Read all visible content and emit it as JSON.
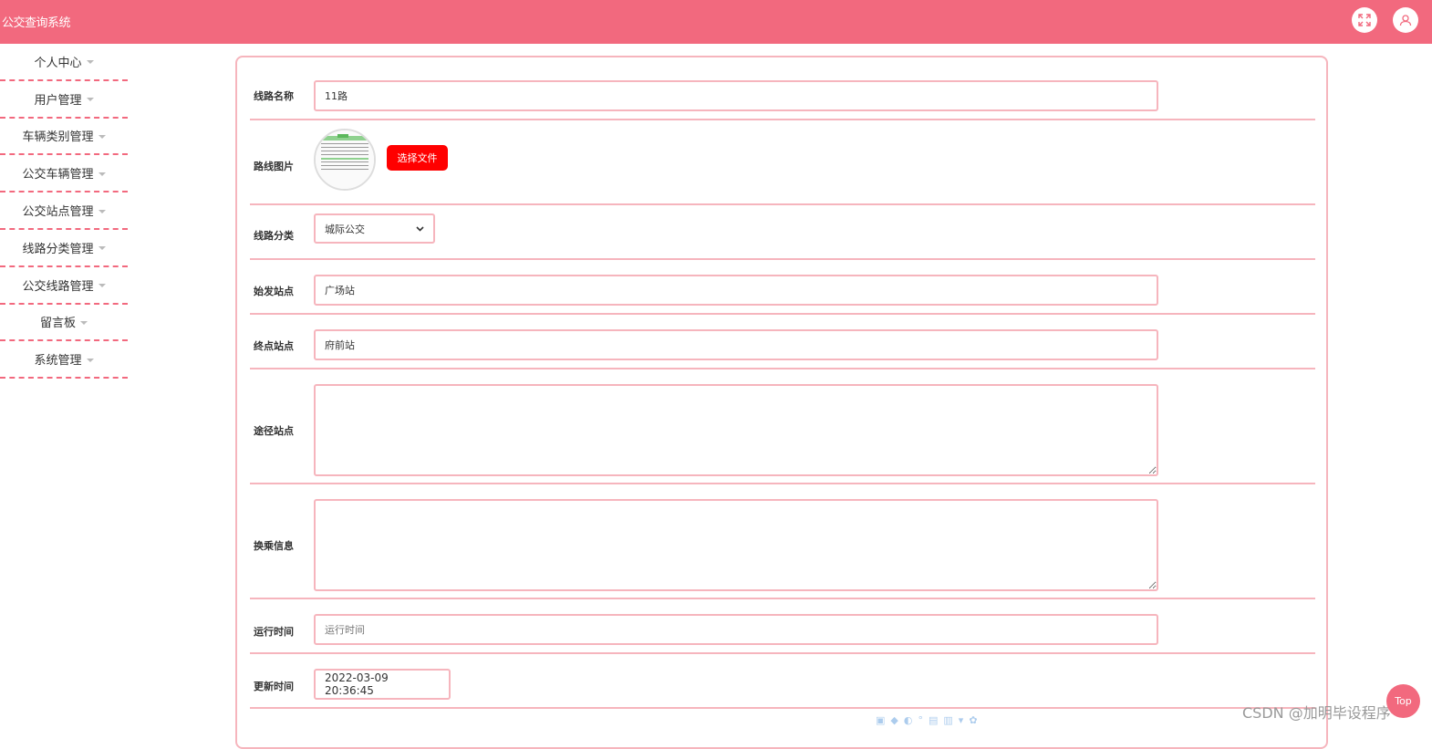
{
  "header": {
    "app_title": "公交查询系统",
    "icons": [
      "fullscreen-icon",
      "user-icon"
    ],
    "bg_color": "#f2697e"
  },
  "sidebar": {
    "items": [
      {
        "label": "个人中心"
      },
      {
        "label": "用户管理"
      },
      {
        "label": "车辆类别管理"
      },
      {
        "label": "公交车辆管理"
      },
      {
        "label": "公交站点管理"
      },
      {
        "label": "线路分类管理"
      },
      {
        "label": "公交线路管理"
      },
      {
        "label": "留言板"
      },
      {
        "label": "系统管理"
      }
    ]
  },
  "form": {
    "route_name": {
      "label": "线路名称",
      "value": "11路"
    },
    "route_image": {
      "label": "路线图片",
      "button": "选择文件"
    },
    "route_category": {
      "label": "线路分类",
      "selected": "城际公交"
    },
    "start_station": {
      "label": "始发站点",
      "value": "广场站"
    },
    "end_station": {
      "label": "终点站点",
      "value": "府前站"
    },
    "via_stations": {
      "label": "途径站点",
      "value": ""
    },
    "transfer_info": {
      "label": "换乘信息",
      "value": ""
    },
    "run_time": {
      "label": "运行时间",
      "placeholder": "运行时间",
      "value": ""
    },
    "update_time": {
      "label": "更新时间",
      "value": "2022-03-09 20:36:45"
    }
  },
  "footer": {
    "top_button": "Top",
    "watermark": "CSDN @加明毕设程序"
  },
  "colors": {
    "accent": "#f2697e",
    "border": "#f6b5bd",
    "file_button": "#ff0000"
  }
}
